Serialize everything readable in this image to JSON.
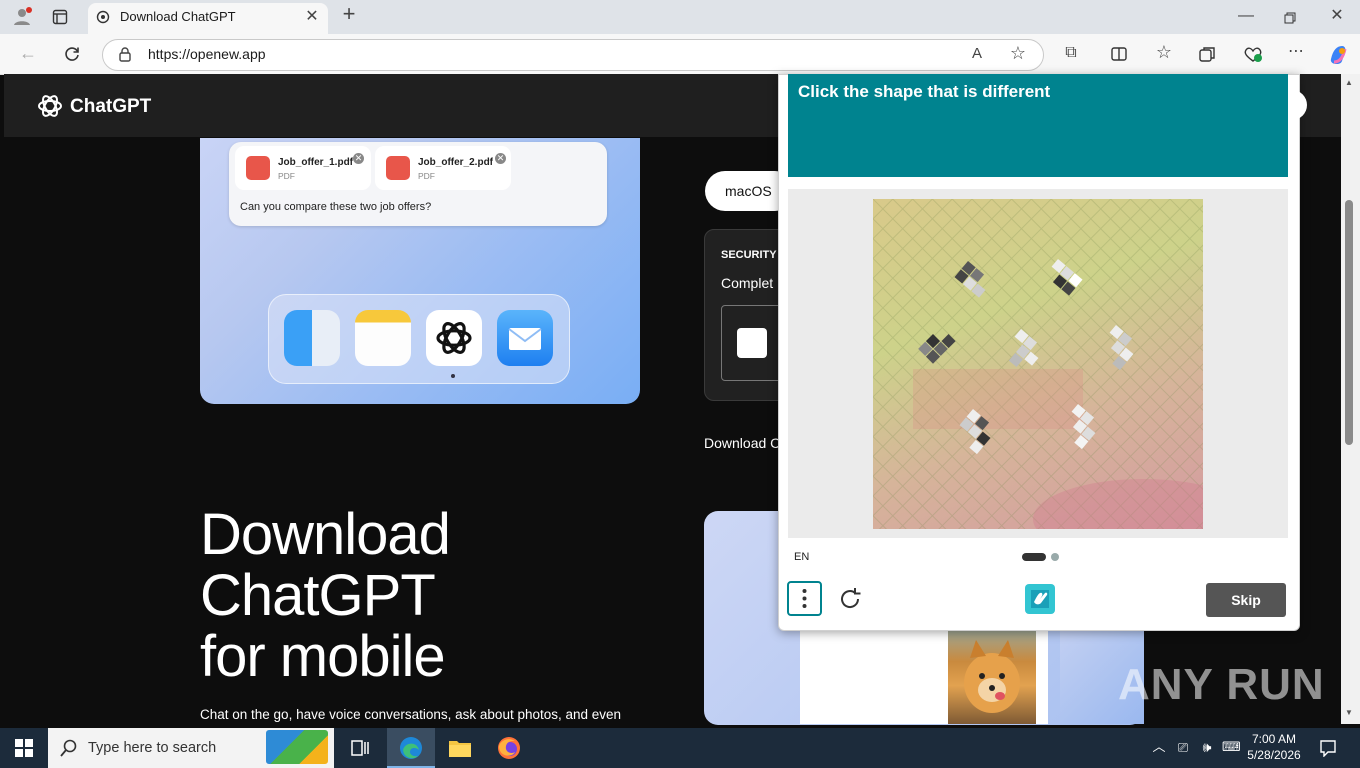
{
  "browser": {
    "tab_title": "Download ChatGPT",
    "new_tab_symbol": "+",
    "url": "https://openew.app",
    "read_aloud_label": "A",
    "window_controls": [
      "minimize-icon",
      "restore-icon",
      "close-icon"
    ]
  },
  "site": {
    "brand": "ChatGPT",
    "hero": {
      "attachments": [
        {
          "name": "Job_offer_1.pdf",
          "type": "PDF"
        },
        {
          "name": "Job_offer_2.pdf",
          "type": "PDF"
        }
      ],
      "prompt": "Can you compare these two job offers?",
      "dock_apps": [
        "finder-icon",
        "notes-icon",
        "chatgpt-icon",
        "mail-icon"
      ]
    },
    "platform_pill": "macOS",
    "security_label": "SECURITY",
    "security_text": "Complet",
    "download_text": "Download C",
    "mobile_title": [
      "Download",
      "ChatGPT",
      "for mobile"
    ],
    "mobile_subtitle": "Chat on the go, have voice conversations, ask about photos, and even"
  },
  "captcha": {
    "prompt": "Click the shape that is different",
    "language": "EN",
    "skip_label": "Skip",
    "page_indicator": {
      "total": 2,
      "active": 1
    }
  },
  "taskbar": {
    "search_placeholder": "Type here to search",
    "time": "7:00 AM",
    "date": "5/28/2026"
  },
  "watermark": "ANY RUN",
  "colors": {
    "captcha_accent": "#00838f",
    "skip_button": "#555555",
    "taskbar": "#1c2b3b"
  }
}
